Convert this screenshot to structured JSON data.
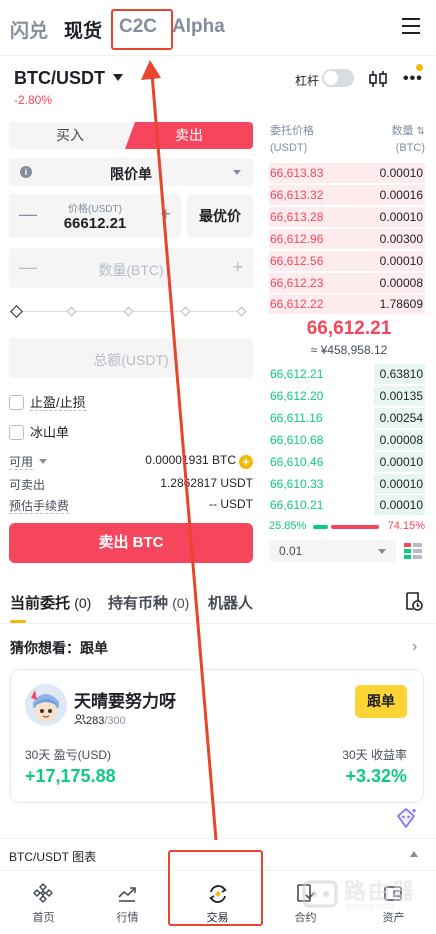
{
  "top_tabs": [
    "闪兑",
    "现货",
    "C2C",
    "Alpha"
  ],
  "pair": {
    "name": "BTC/USDT",
    "change": "-2.80%",
    "leverage_label": "杠杆"
  },
  "form": {
    "buy_label": "买入",
    "sell_label": "卖出",
    "order_type": "限价单",
    "price_placeholder": "价格(USDT)",
    "price_value": "66612.21",
    "best_price": "最优价",
    "qty_placeholder": "数量(BTC)",
    "total_placeholder": "总额(USDT)",
    "tp_sl": "止盈/止损",
    "iceberg": "冰山单",
    "available_label": "可用",
    "available_value": "0.00001931 BTC",
    "sellable_label": "可卖出",
    "sellable_value": "1.2862817 USDT",
    "fee_label": "预估手续费",
    "fee_value": "-- USDT",
    "submit": "卖出 BTC"
  },
  "orderbook": {
    "price_header": "委托价格",
    "price_unit": "(USDT)",
    "qty_header": "数量",
    "qty_unit": "(BTC)",
    "asks": [
      {
        "price": "66,613.83",
        "qty": "0.00010",
        "depth": 1.0
      },
      {
        "price": "66,613.32",
        "qty": "0.00016",
        "depth": 1.0
      },
      {
        "price": "66,613.28",
        "qty": "0.00010",
        "depth": 1.0
      },
      {
        "price": "66,612.96",
        "qty": "0.00300",
        "depth": 1.0
      },
      {
        "price": "66,612.56",
        "qty": "0.00010",
        "depth": 1.0
      },
      {
        "price": "66,612.23",
        "qty": "0.00008",
        "depth": 1.0
      },
      {
        "price": "66,612.22",
        "qty": "1.78609",
        "depth": 1.0
      }
    ],
    "mid_price": "66,612.21",
    "mid_cny": "≈ ¥458,958.12",
    "bids": [
      {
        "price": "66,612.21",
        "qty": "0.63810",
        "depth": 0.33
      },
      {
        "price": "66,612.20",
        "qty": "0.00135",
        "depth": 0.33
      },
      {
        "price": "66,611.16",
        "qty": "0.00254",
        "depth": 0.33
      },
      {
        "price": "66,610.68",
        "qty": "0.00008",
        "depth": 0.33
      },
      {
        "price": "66,610.46",
        "qty": "0.00010",
        "depth": 0.33
      },
      {
        "price": "66,610.33",
        "qty": "0.00010",
        "depth": 0.33
      },
      {
        "price": "66,610.21",
        "qty": "0.00010",
        "depth": 0.33
      }
    ],
    "buy_ratio": "25.85%",
    "sell_ratio": "74.15%",
    "depth_step": "0.01"
  },
  "orders_tabs": [
    {
      "label": "当前委托",
      "count": "(0)"
    },
    {
      "label": "持有币种",
      "count": "(0)"
    },
    {
      "label": "机器人",
      "count": ""
    }
  ],
  "guess": "猜你想看：跟单",
  "trader": {
    "name": "天晴要努力呀",
    "followers": "283",
    "capacity": "/300",
    "follow_label": "跟单",
    "pl_label": "30天 盈亏(USD)",
    "pl_value": "+17,175.88",
    "roi_label": "30天 收益率",
    "roi_value": "+3.32%"
  },
  "chart_bar": "BTC/USDT 图表",
  "nav": [
    "首页",
    "行情",
    "交易",
    "合约",
    "资产"
  ],
  "watermark": {
    "text": "路由器",
    "sub": "luyouqi.com"
  },
  "colors": {
    "red": "#f6465d",
    "green": "#0ecb81",
    "yellow": "#fcd535",
    "annotation": "#e8452c"
  }
}
